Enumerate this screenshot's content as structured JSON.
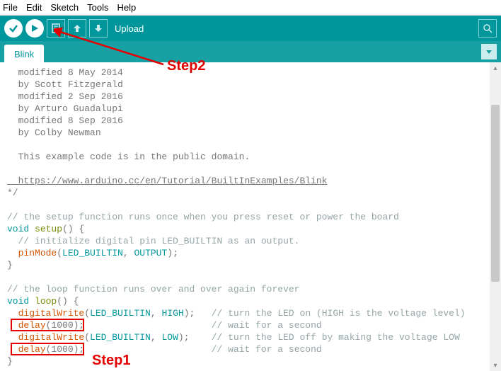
{
  "menu": {
    "file": "File",
    "edit": "Edit",
    "sketch": "Sketch",
    "tools": "Tools",
    "help": "Help"
  },
  "toolbar": {
    "label": "Upload"
  },
  "tabs": {
    "active": "Blink"
  },
  "annotations": {
    "step1": "Step1",
    "step2": "Step2"
  },
  "code": {
    "l1": "  modified 8 May 2014",
    "l2": "  by Scott Fitzgerald",
    "l3": "  modified 2 Sep 2016",
    "l4": "  by Arturo Guadalupi",
    "l5": "  modified 8 Sep 2016",
    "l6": "  by Colby Newman",
    "l7": "",
    "l8": "  This example code is in the public domain.",
    "l9": "",
    "l10": "  https://www.arduino.cc/en/Tutorial/BuiltInExamples/Blink",
    "l11": "*/",
    "l12": "",
    "l13a": "// the setup function runs once when you press reset or power the board",
    "l14a": "void",
    "l14b": " ",
    "l14c": "setup",
    "l14d": "() {",
    "l15a": "  ",
    "l15b": "// initialize digital pin LED_BUILTIN as an output.",
    "l16a": "  ",
    "l16b": "pinMode",
    "l16c": "(",
    "l16d": "LED_BUILTIN",
    "l16e": ", ",
    "l16f": "OUTPUT",
    "l16g": ");",
    "l17": "}",
    "l18": "",
    "l19": "// the loop function runs over and over again forever",
    "l20a": "void",
    "l20b": " ",
    "l20c": "loop",
    "l20d": "() {",
    "l21a": "  ",
    "l21b": "digitalWrite",
    "l21c": "(",
    "l21d": "LED_BUILTIN",
    "l21e": ", ",
    "l21f": "HIGH",
    "l21g": ");   ",
    "l21h": "// turn the LED on (HIGH is the voltage level)",
    "l22a": "  ",
    "l22b": "delay",
    "l22c": "(1000);                       ",
    "l22d": "// wait for a second",
    "l23a": "  ",
    "l23b": "digitalWrite",
    "l23c": "(",
    "l23d": "LED_BUILTIN",
    "l23e": ", ",
    "l23f": "LOW",
    "l23g": ");    ",
    "l23h": "// turn the LED off by making the voltage LOW",
    "l24a": "  ",
    "l24b": "delay",
    "l24c": "(1000);                       ",
    "l24d": "// wait for a second",
    "l25": "}"
  }
}
